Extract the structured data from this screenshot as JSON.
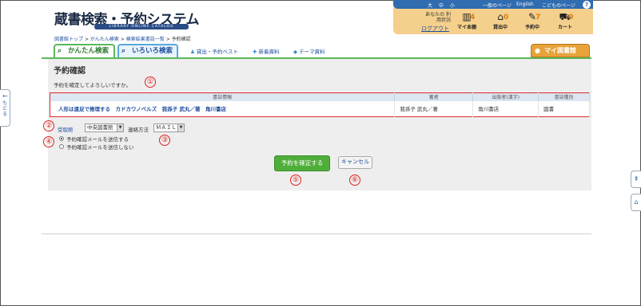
{
  "header": {
    "title": "蔵書検索・予約システム",
    "subtitle": "LIBRARY ONLINE CATALOG",
    "text_size": [
      "大",
      "中",
      "小"
    ],
    "links": [
      "一般のページ",
      "English",
      "こどものページ"
    ],
    "help": "?",
    "status_label": "あなたの 利用状況",
    "logout": "ログアウト",
    "quick": [
      {
        "label": "マイ本棚",
        "count": "4",
        "icon": "bookshelf-icon"
      },
      {
        "label": "貸出中",
        "count": "0",
        "icon": "house-icon"
      },
      {
        "label": "予約中",
        "count": "7",
        "icon": "reserve-icon"
      },
      {
        "label": "カート",
        "count": "0",
        "icon": "cart-icon"
      }
    ]
  },
  "breadcrumb": {
    "items": [
      "図書館トップ",
      "かんたん検索",
      "検索結果書誌一覧",
      "予約確認"
    ],
    "separator": ">"
  },
  "tabs": {
    "easy": "かんたん検索",
    "various": "いろいろ検索",
    "nav": [
      "貸出・予約ベスト",
      "新着資料",
      "テーマ資料"
    ],
    "mylib": "マイ図書館"
  },
  "main": {
    "page_title": "予約確認",
    "message": "予約を確定してよろしいですか。",
    "table": {
      "headers": [
        "書誌情報",
        "著者",
        "出版者(漢字)",
        "書誌種別"
      ],
      "rows": [
        [
          "人形は遠足で推理する　カドカワノベルズ　我孫子 武丸／著　角川書店",
          "我孫子 武丸／著",
          "角川書店",
          "図書"
        ]
      ]
    },
    "pickup_label": "受取館",
    "pickup_value": "中央図書館",
    "contact_label": "連絡方法",
    "contact_value": "ＭＡＩＬ",
    "radio_send": "予約確認メールを送信する",
    "radio_nosend": "予約確認メールを送信しない",
    "confirm_button": "予約を確定する",
    "cancel_button": "キャンセル"
  },
  "annotations": [
    "①",
    "②",
    "③",
    "④",
    "⑤",
    "⑥"
  ],
  "side": {
    "back": "もどる",
    "back_arrow": "←",
    "page_top": "⇞",
    "home": "⌂"
  },
  "colors": {
    "accent_green": "#4fae3a",
    "accent_blue": "#2f6cb0",
    "annotation_red": "#e02020",
    "mylib_orange": "#e9a33b"
  }
}
